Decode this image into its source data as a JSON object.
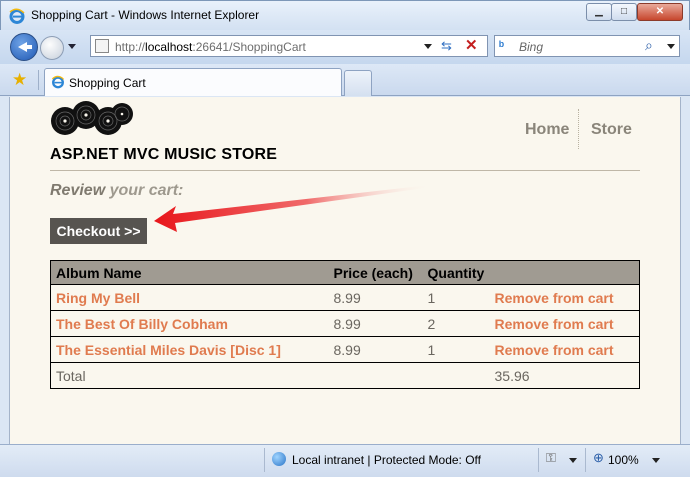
{
  "window": {
    "title": "Shopping Cart - Windows Internet Explorer",
    "minimize_glyph": "▁",
    "maximize_glyph": "□",
    "close_glyph": "✕"
  },
  "address_bar": {
    "url_prefix": "http://",
    "url_host": "localhost",
    "url_rest": ":26641/ShoppingCart"
  },
  "search": {
    "placeholder": "Bing",
    "provider_icon": "bing-icon"
  },
  "tabs": [
    {
      "label": "Shopping Cart"
    }
  ],
  "store": {
    "title": "ASP.NET MVC MUSIC STORE",
    "nav": [
      {
        "label": "Home"
      },
      {
        "label": "Store"
      }
    ]
  },
  "cart": {
    "heading_part1": "Review",
    "heading_part2": " your cart:",
    "checkout_label": "Checkout >>",
    "columns": {
      "album": "Album Name",
      "price": "Price (each)",
      "quantity": "Quantity"
    },
    "items": [
      {
        "album": "Ring My Bell",
        "price": "8.99",
        "quantity": "1",
        "remove": "Remove from cart"
      },
      {
        "album": "The Best Of Billy Cobham",
        "price": "8.99",
        "quantity": "2",
        "remove": "Remove from cart"
      },
      {
        "album": "The Essential Miles Davis [Disc 1]",
        "price": "8.99",
        "quantity": "1",
        "remove": "Remove from cart"
      }
    ],
    "total_label": "Total",
    "total_value": "35.96"
  },
  "status_bar": {
    "zone_text": "Local intranet | Protected Mode: Off",
    "zoom": "100%"
  },
  "colors": {
    "link": "#e07b4f",
    "header_bg": "#a09b92",
    "checkout_bg": "#575450",
    "arrow": "#e8161b",
    "page_bg": "#faf7ee"
  }
}
